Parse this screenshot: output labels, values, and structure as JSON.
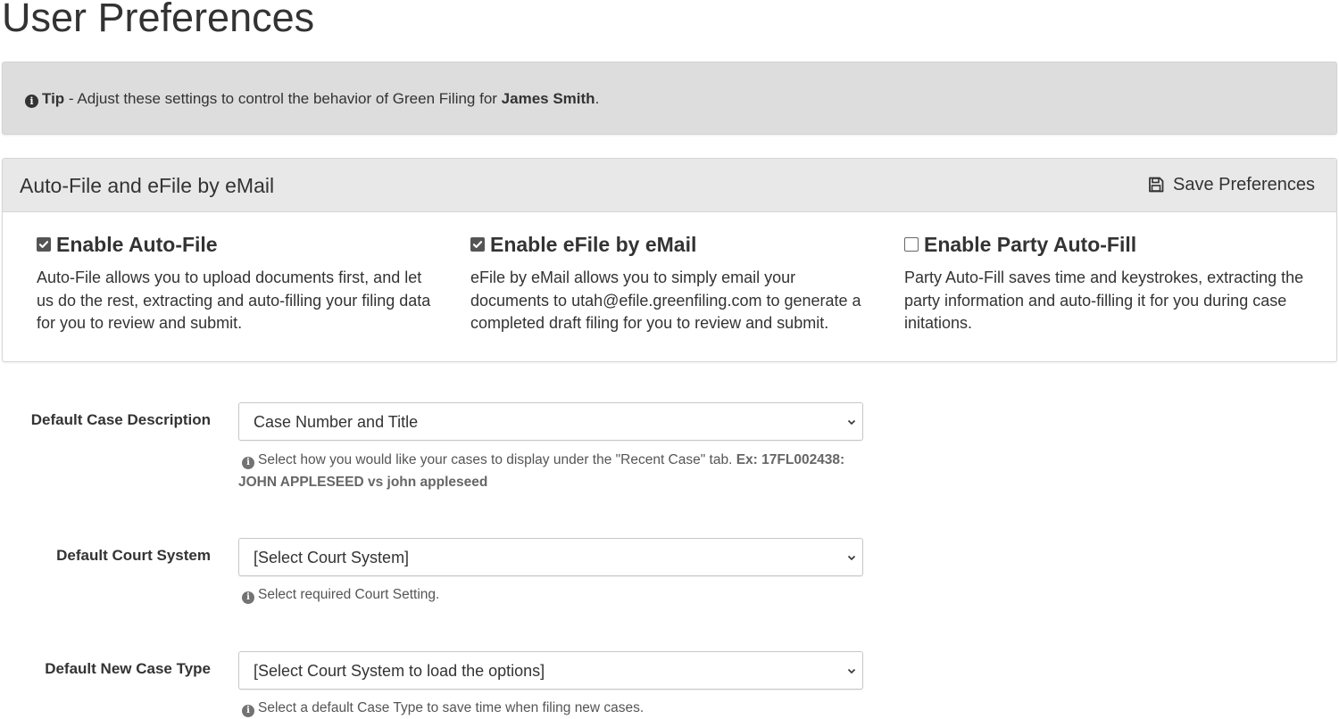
{
  "page": {
    "title": "User Preferences"
  },
  "tip": {
    "label": "Tip",
    "text_before": " - Adjust these settings to control the behavior of Green Filing for ",
    "user_name": "James Smith",
    "text_after": "."
  },
  "panel": {
    "title": "Auto-File and eFile by eMail",
    "save_label": "Save Preferences",
    "options": [
      {
        "title": "Enable Auto-File",
        "checked": true,
        "description": "Auto-File allows you to upload documents first, and let us do the rest, extracting and auto-filling your filing data for you to review and submit."
      },
      {
        "title": "Enable eFile by eMail",
        "checked": true,
        "description": "eFile by eMail allows you to simply email your documents to utah@efile.greenfiling.com to generate a completed draft filing for you to review and submit."
      },
      {
        "title": "Enable Party Auto-Fill",
        "checked": false,
        "description": "Party Auto-Fill saves time and keystrokes, extracting the party information and auto-filling it for you during case initations."
      }
    ]
  },
  "form": {
    "case_description": {
      "label": "Default Case Description",
      "value": "Case Number and Title",
      "help": "Select how you would like your cases to display under the \"Recent Case\" tab. ",
      "help_example": "Ex: 17FL002438: JOHN APPLESEED vs john appleseed"
    },
    "court_system": {
      "label": "Default Court System",
      "value": "[Select Court System]",
      "help": "Select required Court Setting."
    },
    "new_case_type": {
      "label": "Default New Case Type",
      "value": "[Select Court System to load the options]",
      "help": "Select a default Case Type to save time when filing new cases."
    }
  }
}
